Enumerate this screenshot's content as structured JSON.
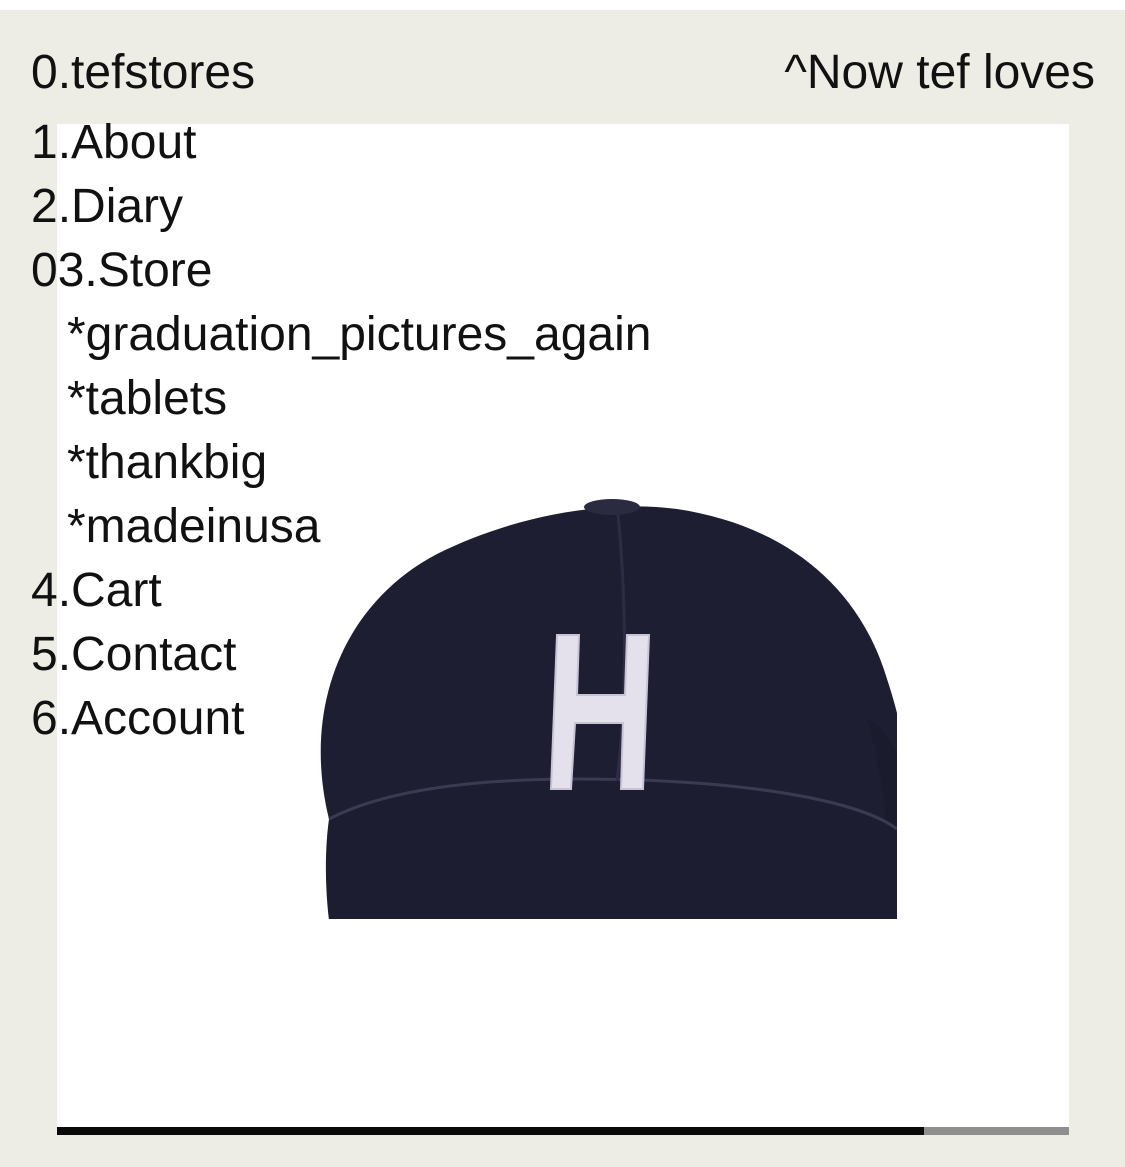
{
  "header": {
    "brand": "0.tefstores",
    "now_link": "^Now tef loves"
  },
  "nav": {
    "about": "1.About",
    "diary": "2.Diary",
    "store": "03.Store",
    "store_items": [
      "*graduation_pictures_again",
      "*tablets",
      "*thankbig",
      "*madeinusa"
    ],
    "cart": "4.Cart",
    "contact": "5.Contact",
    "account": "6.Account"
  },
  "product": {
    "image_icon": "baseball-cap-with-H-logo",
    "cap_color": "#1d1e31",
    "logo_letter": "H"
  },
  "scroll": {
    "progress": 0.857
  },
  "colors": {
    "background": "#edede6",
    "panel": "#ffffff",
    "text": "#111111"
  }
}
